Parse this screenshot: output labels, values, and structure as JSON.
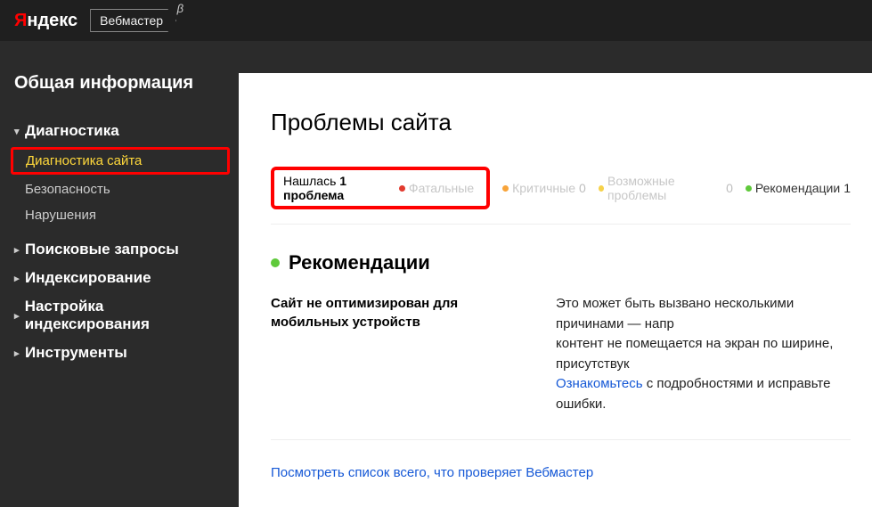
{
  "topbar": {
    "logo_prefix": "Я",
    "logo_rest": "ндекс",
    "product": "Вебмастер",
    "beta": "β"
  },
  "sidebar": {
    "overview": "Общая информация",
    "diagnostics": {
      "label": "Диагностика",
      "items": {
        "site": "Диагностика сайта",
        "security": "Безопасность",
        "violations": "Нарушения"
      }
    },
    "search_queries": "Поисковые запросы",
    "indexing": "Индексирование",
    "indexing_settings": "Настройка индексирования",
    "tools": "Инструменты"
  },
  "content": {
    "title": "Проблемы сайта",
    "found_prefix": "Нашлась ",
    "found_bold": "1 проблема",
    "filters": {
      "fatal": {
        "label": "Фатальные",
        "count": ""
      },
      "critical": {
        "label": "Критичные",
        "count": "0"
      },
      "possible": {
        "label": "Возможные проблемы",
        "count": "0"
      },
      "recommendations": {
        "label": "Рекомендации",
        "count": "1"
      }
    },
    "section": "Рекомендации",
    "issue": {
      "title": "Сайт не оптимизирован для мобильных устройств",
      "desc_line1": "Это может быть вызвано несколькими причинами — напр",
      "desc_line2": "контент не помещается на экран по ширине, присутствук",
      "link_text": "Ознакомьтесь",
      "desc_after_link": " с подробностями и исправьте ошибки."
    },
    "all_link": "Посмотреть список всего, что проверяет Вебмастер"
  }
}
